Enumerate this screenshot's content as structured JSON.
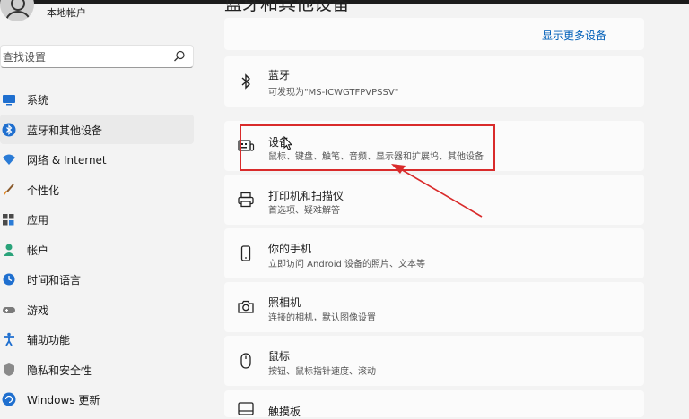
{
  "account": {
    "name": "本地帐户"
  },
  "search": {
    "placeholder": "查找设置"
  },
  "sidebar": {
    "items": [
      {
        "label": "系统",
        "icon": "monitor-icon"
      },
      {
        "label": "蓝牙和其他设备",
        "icon": "bluetooth-icon",
        "active": true
      },
      {
        "label": "网络 & Internet",
        "icon": "wifi-icon"
      },
      {
        "label": "个性化",
        "icon": "brush-icon"
      },
      {
        "label": "应用",
        "icon": "apps-icon"
      },
      {
        "label": "帐户",
        "icon": "person-icon"
      },
      {
        "label": "时间和语言",
        "icon": "clock-globe-icon"
      },
      {
        "label": "游戏",
        "icon": "gamepad-icon"
      },
      {
        "label": "辅助功能",
        "icon": "accessibility-icon"
      },
      {
        "label": "隐私和安全性",
        "icon": "shield-icon"
      },
      {
        "label": "Windows 更新",
        "icon": "update-icon"
      }
    ]
  },
  "main": {
    "title": "蓝牙和其他设备",
    "show_more": "显示更多设备",
    "cards": [
      {
        "title": "蓝牙",
        "subtitle": "可发现为\"MS-ICWGTFPVPSSV\"",
        "icon": "bluetooth-icon"
      },
      {
        "title": "设备",
        "subtitle": "鼠标、键盘、触笔、音频、显示器和扩展坞、其他设备",
        "icon": "devices-icon"
      },
      {
        "title": "打印机和扫描仪",
        "subtitle": "首选项、疑难解答",
        "icon": "printer-icon"
      },
      {
        "title": "你的手机",
        "subtitle": "立即访问 Android 设备的照片、文本等",
        "icon": "phone-icon"
      },
      {
        "title": "照相机",
        "subtitle": "连接的相机，默认图像设置",
        "icon": "camera-icon"
      },
      {
        "title": "鼠标",
        "subtitle": "按钮、鼠标指针速度、滚动",
        "icon": "mouse-icon"
      },
      {
        "title": "触摸板",
        "subtitle": "",
        "icon": "touchpad-icon"
      }
    ]
  },
  "colors": {
    "accent": "#005fb8",
    "annotation": "#d92b2b",
    "background": "#f3f3f3",
    "card": "#fbfbfb"
  }
}
